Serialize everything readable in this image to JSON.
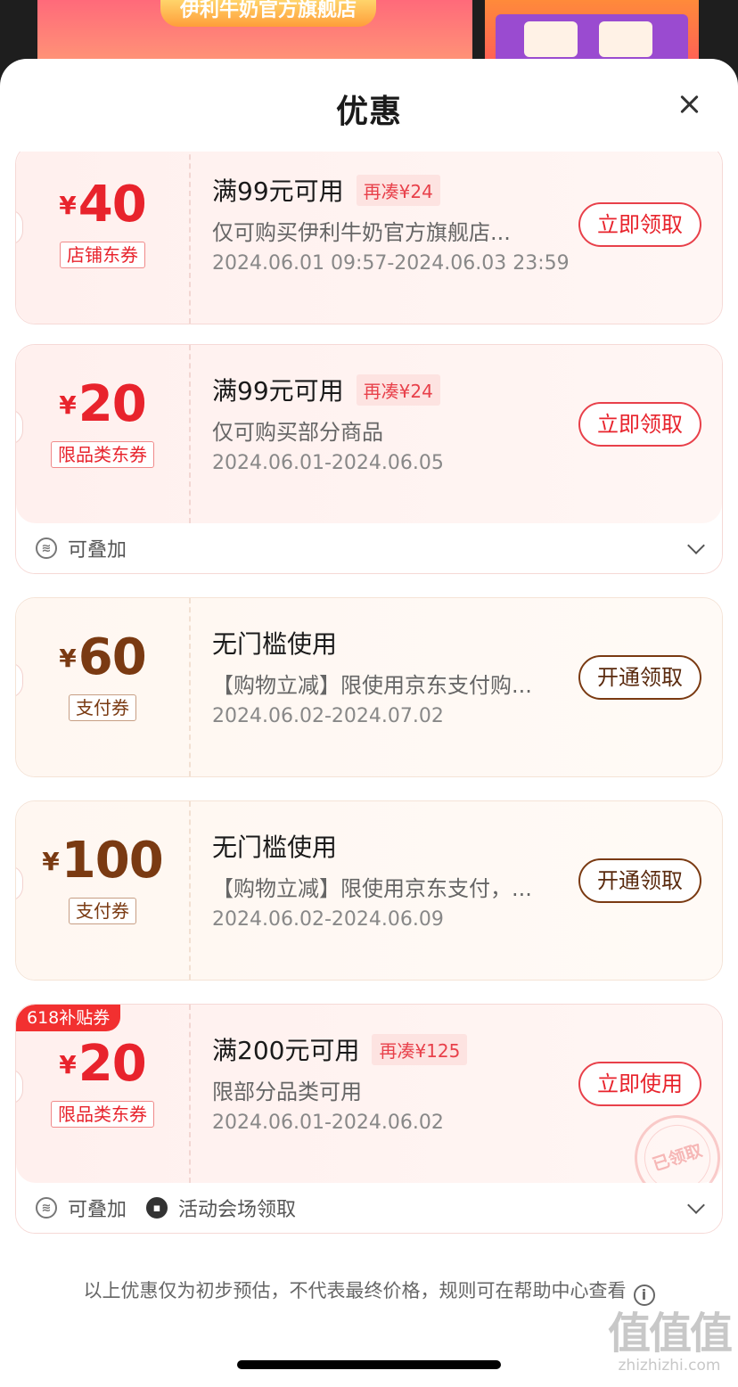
{
  "backdrop": {
    "banner_title": "伊利牛奶官方旗舰店"
  },
  "sheet": {
    "title": "优惠"
  },
  "coupons": [
    {
      "currency": "¥",
      "amount": "40",
      "tag": "店铺东券",
      "condition": "满99元可用",
      "extra": "再凑¥24",
      "scope": "仅可购买伊利牛奶官方旗舰店...",
      "date": "2024.06.01 09:57-2024.06.03 23:59",
      "button": "立即领取"
    },
    {
      "currency": "¥",
      "amount": "20",
      "tag": "限品类东券",
      "condition": "满99元可用",
      "extra": "再凑¥24",
      "scope": "仅可购买部分商品",
      "date": "2024.06.01-2024.06.05",
      "button": "立即领取",
      "footer_stack": "可叠加"
    },
    {
      "currency": "¥",
      "amount": "60",
      "tag": "支付券",
      "condition": "无门槛使用",
      "scope": "【购物立减】限使用京东支付购...",
      "date": "2024.06.02-2024.07.02",
      "button": "开通领取"
    },
    {
      "currency": "¥",
      "amount": "100",
      "tag": "支付券",
      "condition": "无门槛使用",
      "scope": "【购物立减】限使用京东支付，...",
      "date": "2024.06.02-2024.06.09",
      "button": "开通领取"
    },
    {
      "ribbon": "618补贴券",
      "currency": "¥",
      "amount": "20",
      "tag": "限品类东券",
      "condition": "满200元可用",
      "extra": "再凑¥125",
      "scope": "限部分品类可用",
      "date": "2024.06.01-2024.06.02",
      "button": "立即使用",
      "stamp": "已领取",
      "footer_stack": "可叠加",
      "footer_venue": "活动会场领取"
    }
  ],
  "disclaimer": "以上优惠仅为初步预估，不代表最终价格，规则可在帮助中心查看",
  "watermark": {
    "logo": "值值值",
    "url": "zhizhizhi.com"
  },
  "colors": {
    "red_accent": "#e8232c",
    "brown_accent": "#7a3a12",
    "ribbon": "#f23030"
  }
}
